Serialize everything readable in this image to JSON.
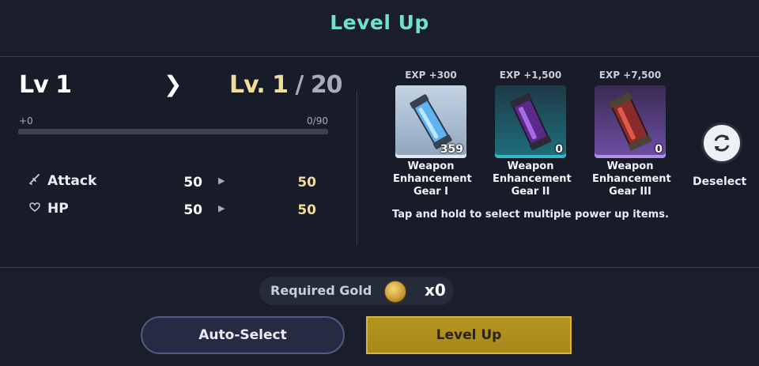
{
  "header": {
    "title": "Level Up"
  },
  "level": {
    "current_label": "Lv 1",
    "next_prefix": "Lv. 1",
    "next_separator": " / ",
    "max": "20",
    "exp_gain": "+0",
    "exp_progress_text": "0/90",
    "exp_fraction": 0
  },
  "stats": [
    {
      "icon": "sword-icon",
      "label": "Attack",
      "current": "50",
      "new": "50"
    },
    {
      "icon": "heart-icon",
      "label": "HP",
      "current": "50",
      "new": "50"
    }
  ],
  "items": [
    {
      "exp": "EXP +300",
      "count": "359",
      "name_lines": [
        "Weapon",
        "Enhancement",
        "Gear I"
      ],
      "accent": "#dfe8f2"
    },
    {
      "exp": "EXP +1,500",
      "count": "0",
      "name_lines": [
        "Weapon",
        "Enhancement",
        "Gear II"
      ],
      "accent": "#38b7c4"
    },
    {
      "exp": "EXP +7,500",
      "count": "0",
      "name_lines": [
        "Weapon",
        "Enhancement",
        "Gear III"
      ],
      "accent": "#b58ee8"
    }
  ],
  "hint": "Tap and hold to select multiple power up items.",
  "deselect_label": "Deselect",
  "gold": {
    "label": "Required Gold",
    "value": "x0"
  },
  "buttons": {
    "auto_select": "Auto-Select",
    "level_up": "Level Up"
  },
  "colors": {
    "accent": "#72e0cf",
    "gold": "#f1dc9a",
    "button_gold": "#b49420"
  }
}
